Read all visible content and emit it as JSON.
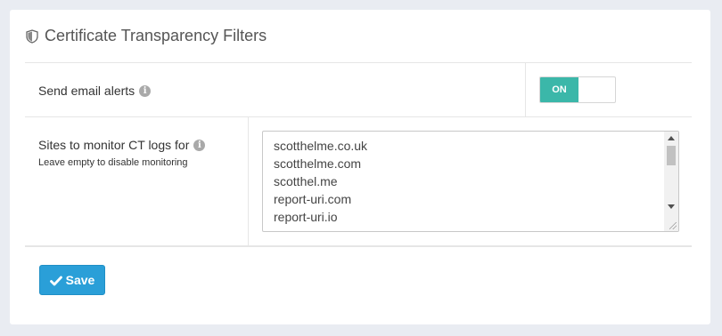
{
  "panel": {
    "title": "Certificate Transparency Filters",
    "title_icon": "shield-icon"
  },
  "email_alerts": {
    "label": "Send email alerts",
    "info_icon": "info-icon",
    "toggle_label": "ON",
    "toggle_state": "on",
    "accent_color": "#3bb7a9"
  },
  "sites": {
    "label": "Sites to monitor CT logs for",
    "help": "Leave empty to disable monitoring",
    "info_icon": "info-icon",
    "lines": [
      "scotthelme.co.uk",
      "scotthelme.com",
      "scotthel.me",
      "report-uri.com",
      "report-uri.io"
    ]
  },
  "actions": {
    "save_label": "Save",
    "save_icon": "checkmark-icon",
    "button_color": "#2a9fd8"
  }
}
